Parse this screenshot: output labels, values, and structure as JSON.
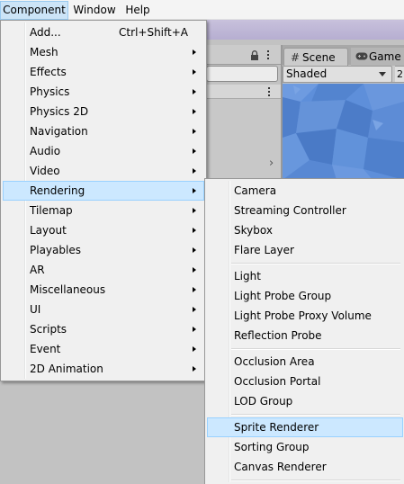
{
  "menubar": {
    "items": [
      "Component",
      "Window",
      "Help"
    ]
  },
  "scene": {
    "tab_scene": "Scene",
    "tab_game": "Game",
    "shading_mode": "Shaded",
    "mode_2d": "2"
  },
  "component_menu": {
    "items": [
      {
        "label": "Add...",
        "shortcut": "Ctrl+Shift+A"
      },
      {
        "label": "Mesh"
      },
      {
        "label": "Effects"
      },
      {
        "label": "Physics"
      },
      {
        "label": "Physics 2D"
      },
      {
        "label": "Navigation"
      },
      {
        "label": "Audio"
      },
      {
        "label": "Video"
      },
      {
        "label": "Rendering"
      },
      {
        "label": "Tilemap"
      },
      {
        "label": "Layout"
      },
      {
        "label": "Playables"
      },
      {
        "label": "AR"
      },
      {
        "label": "Miscellaneous"
      },
      {
        "label": "UI"
      },
      {
        "label": "Scripts"
      },
      {
        "label": "Event"
      },
      {
        "label": "2D Animation"
      }
    ],
    "selected": "Rendering"
  },
  "rendering_submenu": {
    "items": [
      "Camera",
      "Streaming Controller",
      "Skybox",
      "Flare Layer",
      "Light",
      "Light Probe Group",
      "Light Probe Proxy Volume",
      "Reflection Probe",
      "Occlusion Area",
      "Occlusion Portal",
      "LOD Group",
      "Sprite Renderer",
      "Sorting Group",
      "Canvas Renderer"
    ],
    "selected": "Sprite Renderer"
  },
  "icons": {
    "submenu_arrow": "chevron-right-icon",
    "scene_tab": "hash-icon",
    "game_tab": "gamepad-icon",
    "lock": "lock-icon",
    "kebab": "kebab-menu-icon"
  },
  "colors": {
    "menu_background": "#f0f0f0",
    "menu_highlight": "#cce8ff",
    "menubar_active": "#cce4f7",
    "scene_sky": "#5a8bd6"
  }
}
